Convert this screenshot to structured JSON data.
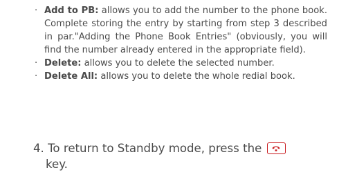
{
  "bullets": [
    {
      "term": "Add to PB:",
      "text": " allows you to add the number to the phone book. Complete storing the entry by starting from step 3 described in par.\"Adding the Phone Book Entries\" (obviously, you will find the number already entered in the appropriate field)."
    },
    {
      "term": "Delete:",
      "text": " allows you to delete the selected number."
    },
    {
      "term": "Delete All:",
      "text": " allows you to delete the whole redial book."
    }
  ],
  "step": {
    "number": "4.",
    "text": " To return to Standby mode, press the",
    "continuation": "key."
  },
  "icons": {
    "end_key": "end-call-key-icon"
  },
  "colors": {
    "text": "#4a4a4a",
    "key_accent": "#c8181c"
  }
}
